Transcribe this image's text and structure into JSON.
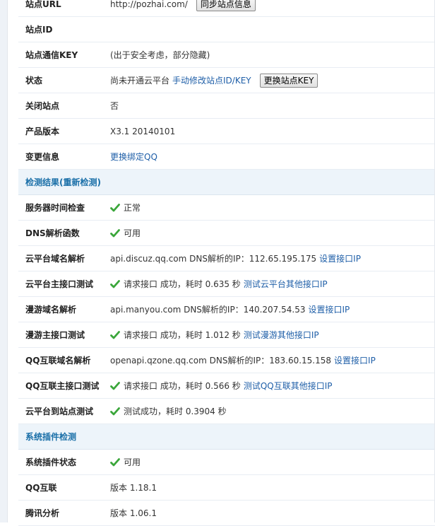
{
  "rows": [
    {
      "label": "站点URL",
      "value": "http://pozhai.com/",
      "button": "同步站点信息"
    },
    {
      "label": "站点ID",
      "value": ""
    },
    {
      "label": "站点通信KEY",
      "value": "(出于安全考虑，部分隐藏)"
    },
    {
      "label": "状态",
      "value": "尚未开通云平台",
      "link": "手动修改站点ID/KEY",
      "button": "更换站点KEY"
    },
    {
      "label": "关闭站点",
      "value": "否"
    },
    {
      "label": "产品版本",
      "value": "X3.1 20140101"
    },
    {
      "label": "变更信息",
      "link": "更换绑定QQ"
    }
  ],
  "section1": {
    "title": "检测结果",
    "link": "(重新检测)"
  },
  "checks": [
    {
      "label": "服务器时间检查",
      "icon": "check-icon",
      "value": "正常"
    },
    {
      "label": "DNS解析函数",
      "icon": "check-icon",
      "value": "可用"
    },
    {
      "label": "云平台域名解析",
      "value": "api.discuz.qq.com DNS解析的IP：112.65.195.175",
      "link": "设置接口IP"
    },
    {
      "label": "云平台主接口测试",
      "icon": "check-icon",
      "value": "请求接口 成功，耗时 0.635 秒",
      "link": "测试云平台其他接口IP"
    },
    {
      "label": "漫游域名解析",
      "value": "api.manyou.com DNS解析的IP：140.207.54.53",
      "link": "设置接口IP"
    },
    {
      "label": "漫游主接口测试",
      "icon": "check-icon",
      "value": "请求接口 成功，耗时 1.012 秒",
      "link": "测试漫游其他接口IP"
    },
    {
      "label": "QQ互联域名解析",
      "value": "openapi.qzone.qq.com DNS解析的IP：183.60.15.158",
      "link": "设置接口IP"
    },
    {
      "label": "QQ互联主接口测试",
      "icon": "check-icon",
      "value": "请求接口 成功，耗时 0.566 秒",
      "link": "测试QQ互联其他接口IP"
    },
    {
      "label": "云平台到站点测试",
      "icon": "check-icon",
      "value": "测试成功，耗时 0.3904 秒"
    }
  ],
  "section2": {
    "title": "系统插件检测"
  },
  "plugins": [
    {
      "label": "系统插件状态",
      "icon": "check-icon",
      "value": "可用"
    },
    {
      "label": "QQ互联",
      "value": "版本 1.18.1"
    },
    {
      "label": "腾讯分析",
      "value": "版本 1.06.1"
    }
  ],
  "colors": {
    "accent": "#1a6fa8",
    "link": "#1f5fa8",
    "check": "#3aa63a",
    "section_bg": "#edf4fa"
  }
}
